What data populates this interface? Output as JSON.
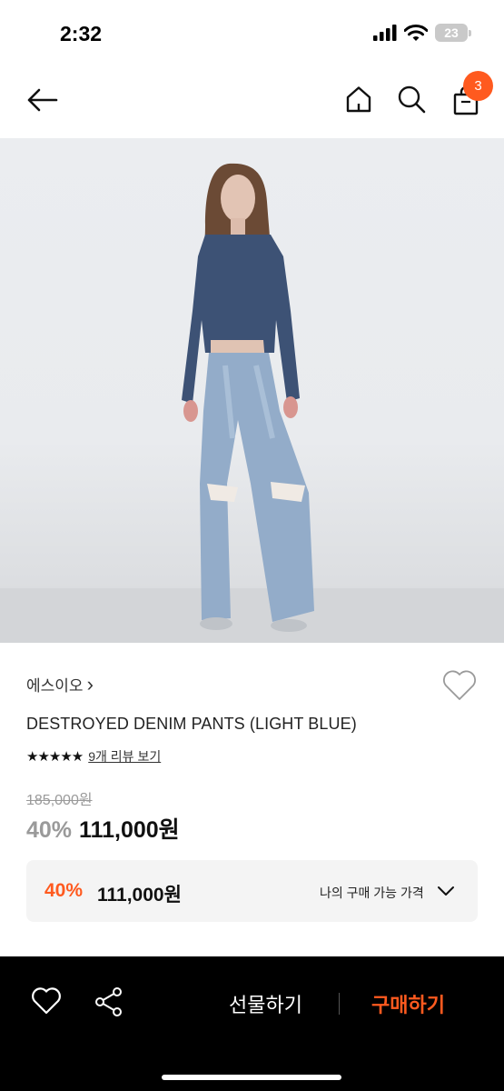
{
  "status_bar": {
    "time": "2:32",
    "battery": "23"
  },
  "nav": {
    "cart_count": "3"
  },
  "product": {
    "brand": "에스이오",
    "brand_chevron": "›",
    "title": "DESTROYED DENIM PANTS (LIGHT BLUE)",
    "rating_stars": "★★★★★",
    "rating_value": 4.5,
    "review_link": "9개 리뷰 보기",
    "original_price": "185,000원",
    "discount": "40%",
    "sale_price": "111,000원"
  },
  "my_price": {
    "discount": "40%",
    "price": "111,000원",
    "label": "나의 구매 가능 가격"
  },
  "bottom_bar": {
    "gift_label": "선물하기",
    "buy_label": "구매하기"
  },
  "colors": {
    "accent": "#ff5a1f",
    "bottom_bar_bg": "#000000"
  },
  "icons": [
    "back-arrow-icon",
    "home-icon",
    "search-icon",
    "cart-icon",
    "heart-icon",
    "share-icon",
    "chevron-down-icon",
    "signal-icon",
    "wifi-icon",
    "battery-icon"
  ]
}
